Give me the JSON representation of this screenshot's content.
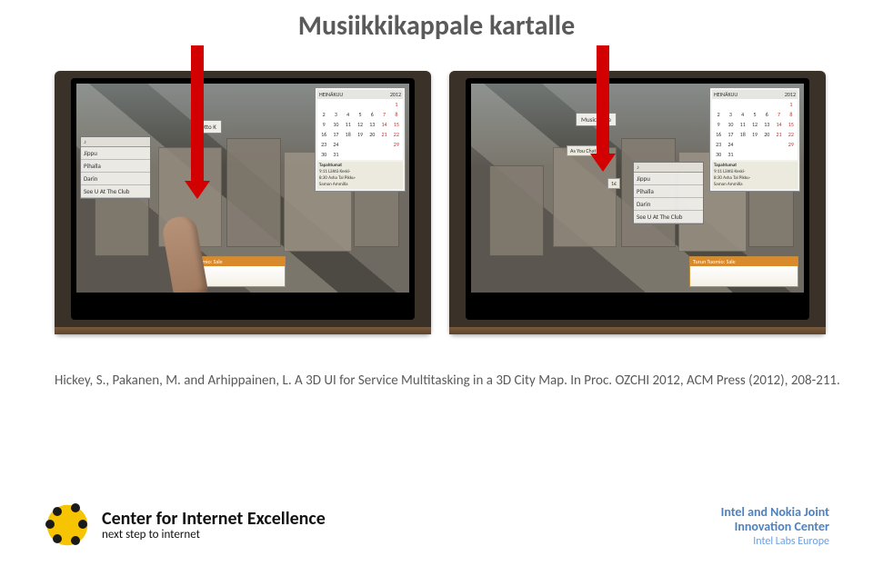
{
  "title": "Musiikkikappale kartalle",
  "citation": "Hickey, S., Pakanen, M. and Arhippainen, L. A 3D UI for Service Multitasking in a 3D City Map. In Proc. OZCHI 2012, ACM Press (2012), 208-211.",
  "calendar": {
    "month": "HEINÄKUU",
    "year": "2012",
    "days": [
      "",
      "",
      "",
      "",
      "",
      "",
      "1",
      "2",
      "3",
      "4",
      "5",
      "6",
      "7",
      "8",
      "9",
      "10",
      "11",
      "12",
      "13",
      "14",
      "15",
      "16",
      "17",
      "18",
      "19",
      "20",
      "21",
      "22",
      "23",
      "24",
      "",
      "",
      "",
      "",
      "29",
      "30",
      "31",
      "",
      "",
      "",
      "",
      ""
    ],
    "events_title": "Tapahtumat",
    "events": [
      "9:11  Lähtö Keski-",
      "8:30  Asha Tal Pikku-",
      "         Saman Ammilla"
    ]
  },
  "store": {
    "left_label": "Otto K",
    "right_label": "Music store"
  },
  "songs": {
    "items": [
      "Jippu",
      "Pihalla",
      "Darin",
      "See U At The Club"
    ]
  },
  "float_labels": {
    "f1": "As You Chat",
    "f2": "1€",
    "f3": "1€"
  },
  "card": {
    "header": "Turun Tuomio: Sale"
  },
  "footer": {
    "cie_title": "Center for Internet Excellence",
    "cie_sub": "next step to internet",
    "right_l1": "Intel and Nokia Joint",
    "right_l2": "Innovation Center",
    "right_l3": "Intel Labs Europe"
  }
}
